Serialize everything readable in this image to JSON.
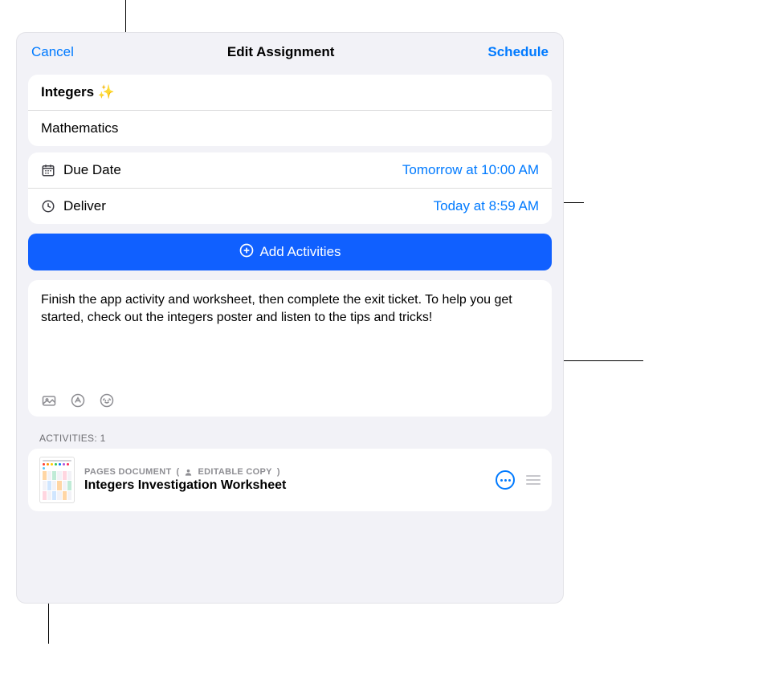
{
  "header": {
    "cancel_label": "Cancel",
    "title": "Edit Assignment",
    "schedule_label": "Schedule"
  },
  "titleCard": {
    "title": "Integers ✨",
    "class": "Mathematics"
  },
  "schedule": {
    "due_label": "Due Date",
    "due_value": "Tomorrow at 10:00 AM",
    "deliver_label": "Deliver",
    "deliver_value": "Today at 8:59 AM"
  },
  "addActivities": {
    "label": "Add Activities"
  },
  "instructions": {
    "text": "Finish the app activity and worksheet, then complete the exit ticket. To help you get started, check out the integers poster and listen to the tips and tricks!"
  },
  "activities": {
    "header": "Activities: 1",
    "item": {
      "type_label": "Pages Document",
      "badge_label": "Editable Copy",
      "title": "Integers Investigation Worksheet"
    }
  }
}
